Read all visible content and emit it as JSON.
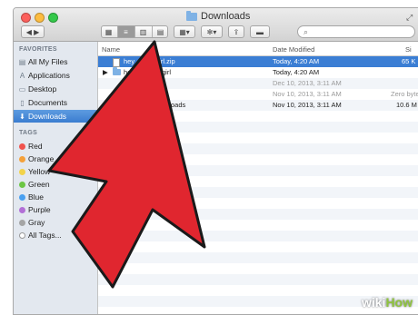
{
  "window": {
    "title": "Downloads"
  },
  "toolbar": {
    "view_icons": [
      "icon-view-icon",
      "list-view-icon",
      "column-view-icon",
      "coverflow-view-icon"
    ],
    "search_placeholder": ""
  },
  "sidebar": {
    "favorites_heading": "FAVORITES",
    "favorites": [
      {
        "label": "All My Files",
        "icon": "all-files-icon"
      },
      {
        "label": "Applications",
        "icon": "applications-icon"
      },
      {
        "label": "Desktop",
        "icon": "desktop-icon"
      },
      {
        "label": "Documents",
        "icon": "documents-icon"
      },
      {
        "label": "Downloads",
        "icon": "downloads-icon",
        "selected": true
      }
    ],
    "tags_heading": "TAGS",
    "tags": [
      {
        "label": "Red",
        "color": "#f0524d"
      },
      {
        "label": "Orange",
        "color": "#f5a13a"
      },
      {
        "label": "Yellow",
        "color": "#f2d34a"
      },
      {
        "label": "Green",
        "color": "#6cc644"
      },
      {
        "label": "Blue",
        "color": "#4aa0f0"
      },
      {
        "label": "Purple",
        "color": "#b26fd6"
      },
      {
        "label": "Gray",
        "color": "#a5a5a5"
      },
      {
        "label": "All Tags...",
        "color": "#ffffff"
      }
    ]
  },
  "columns": {
    "name": "Name",
    "date": "Date Modified",
    "size": "Si"
  },
  "rows": [
    {
      "name": "hey_",
      "name_tail": "girl.zip",
      "date": "Today, 4:20 AM",
      "size": "65 K",
      "selected": true
    },
    {
      "name": "hey_",
      "name_tail": "girl",
      "date": "Today, 4:20 AM",
      "size": "",
      "folder": true
    },
    {
      "name": "",
      "name_tail": "",
      "date": "Dec 10, 2013, 3:11 AM",
      "size": "",
      "dim": true
    },
    {
      "name": "",
      "name_tail": "",
      "date": "Nov 10, 2013, 3:11 AM",
      "size": "Zero byte",
      "dim": true
    },
    {
      "name": "",
      "name_tail": "oads",
      "date": "Nov 10, 2013, 3:11 AM",
      "size": "10.6 M"
    }
  ],
  "watermark": {
    "prefix": "wiki",
    "suffix": "How"
  }
}
